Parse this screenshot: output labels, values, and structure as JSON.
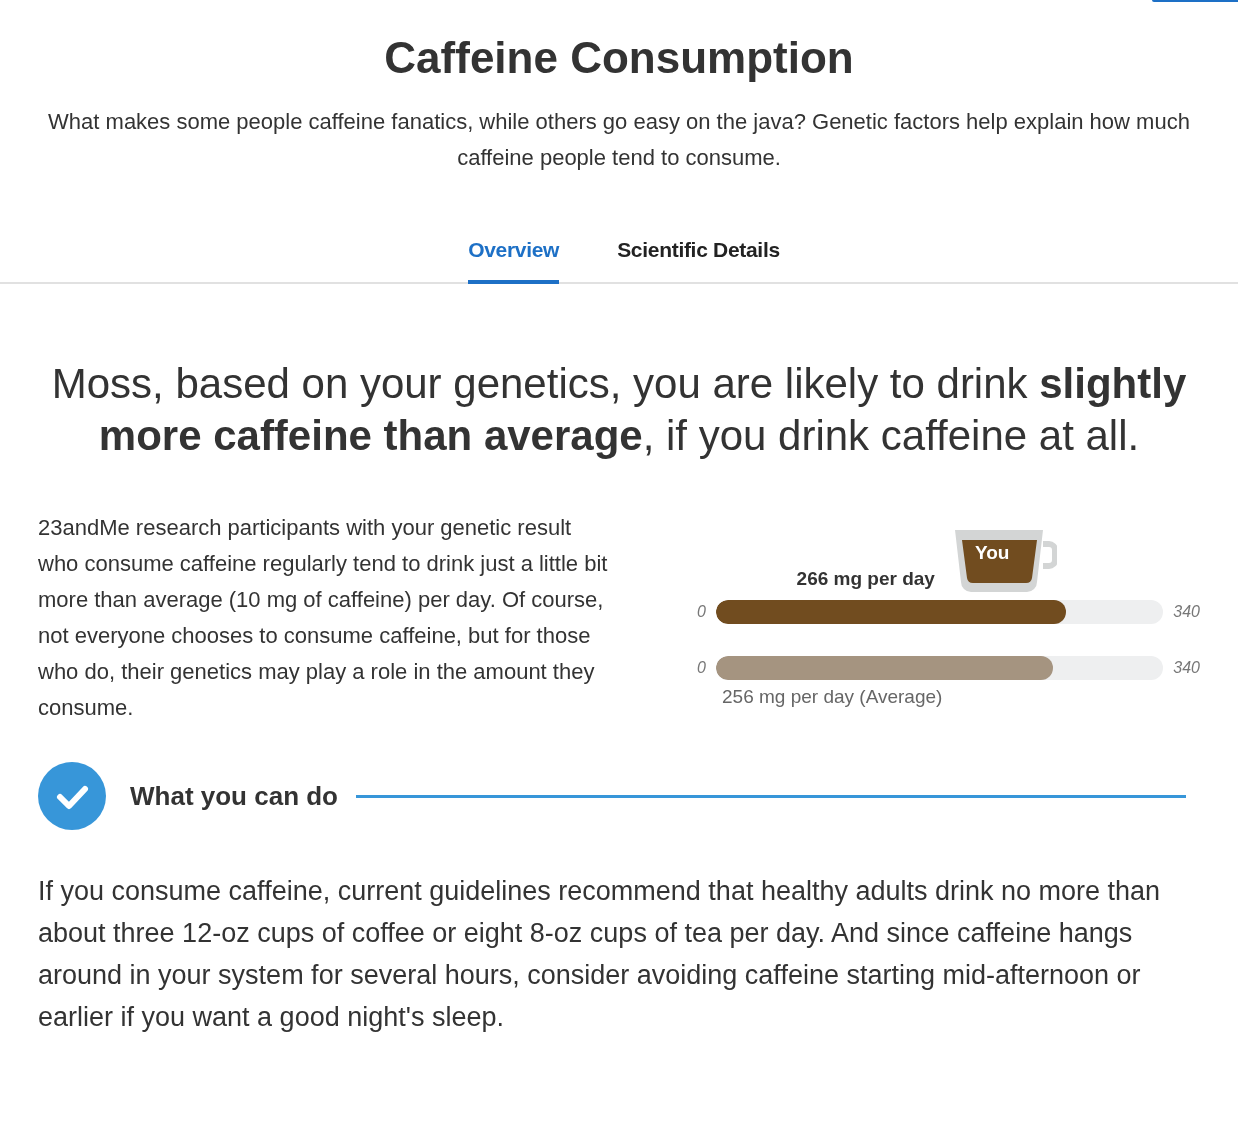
{
  "header": {
    "title": "Caffeine Consumption",
    "subtitle": "What makes some people caffeine fanatics, while others go easy on the java? Genetic factors help explain how much caffeine people tend to consume."
  },
  "tabs": [
    {
      "label": "Overview",
      "selected": true
    },
    {
      "label": "Scientific Details",
      "selected": false
    }
  ],
  "headline": "Moss, based on your genetics, you are likely to drink **slightly more caffeine than average**, if you drink caffeine at all.",
  "summary": "23andMe research participants with your genetic result who consume caffeine regularly tend to drink just a little bit more than average (10 mg of caffeine) per day. Of course, not everyone chooses to consume caffeine, but for those who do, their genetics may play a role in the amount they consume.",
  "comparison": {
    "bars": [
      {
        "kind": "you",
        "label": "266 mg per day",
        "badge": "You",
        "min": "0",
        "max": "340",
        "level": 0.782
      },
      {
        "kind": "average",
        "label": "256 mg per day (Average)",
        "min": "0",
        "max": "340",
        "level": 0.753
      }
    ]
  },
  "action": {
    "heading": "What you can do",
    "text": "If you consume caffeine, current guidelines recommend that healthy adults drink no more than about three 12-oz cups of coffee or eight 8-oz cups of tea per day. And since caffeine hangs around in your system for several hours, consider avoiding caffeine starting mid-afternoon or earlier if you want a good night's sleep."
  }
}
